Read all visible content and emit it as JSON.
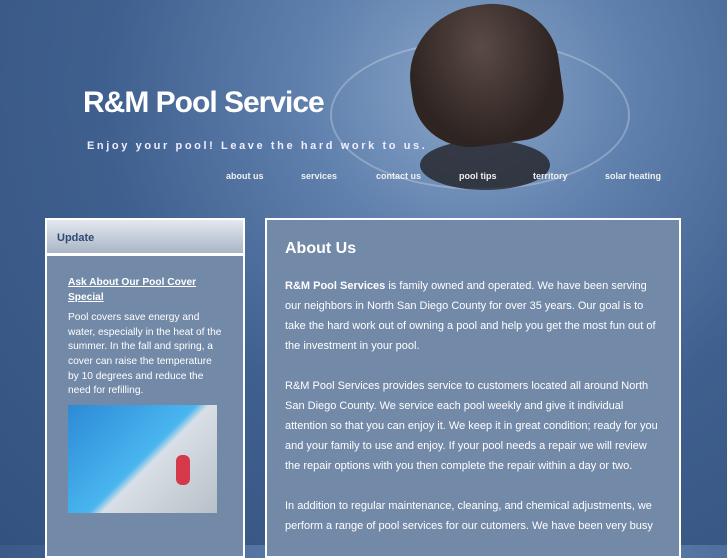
{
  "header": {
    "title": "R&M Pool Service",
    "tagline": "Enjoy your pool! Leave the hard work to us."
  },
  "nav": [
    "about us",
    "services",
    "contact us",
    "pool tips",
    "territory",
    "solar heating"
  ],
  "sidebar": {
    "heading": "Update",
    "link": "Ask About Our Pool Cover Special",
    "text": "Pool covers save energy and water, especially in the heat of the summer.  In the fall and spring, a cover can raise the temperature by 10 degrees and reduce the need for refilling."
  },
  "main": {
    "heading": "About Us",
    "company": "R&M Pool Services",
    "p1": " is family owned and operated. We have been serving our neighbors in North San Diego County for over 35 years. Our goal is to take the hard work out of owning a pool and help you get the most fun out of the investment in your pool.",
    "p2": "R&M Pool Services provides service to customers located all around North San Diego County.  We service each pool weekly and  give it individual attention so that you can enjoy it.  We keep it in great condition; ready for you and your family to use and enjoy. If your pool needs a repair we will review the repair options with you then complete the repair within a day or two.",
    "p3": "In addition to regular maintenance, cleaning, and chemical adjustments, we perform a range of pool services for our cutomers.  We have been very busy"
  }
}
